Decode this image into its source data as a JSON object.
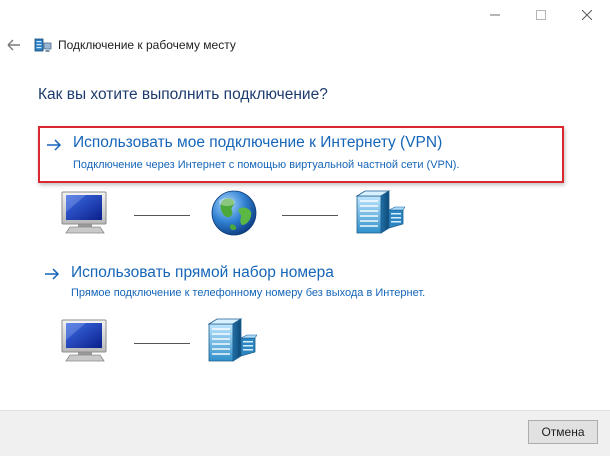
{
  "window": {
    "title": "Подключение к рабочему месту",
    "controls": {
      "minimize_icon": "minimize-icon",
      "maximize_icon": "maximize-icon",
      "close_icon": "close-icon"
    }
  },
  "question": "Как вы хотите выполнить подключение?",
  "options": [
    {
      "title": "Использовать мое подключение к Интернету (VPN)",
      "description": "Подключение через Интернет с помощью виртуальной частной сети (VPN).",
      "icons": [
        "computer-icon",
        "globe-icon",
        "server-icon"
      ],
      "highlighted": true
    },
    {
      "title": "Использовать прямой набор номера",
      "description": "Прямое подключение к телефонному номеру без выхода в Интернет.",
      "icons": [
        "computer-icon",
        "server-icon"
      ],
      "highlighted": false
    }
  ],
  "footer": {
    "cancel_label": "Отмена"
  },
  "colors": {
    "link": "#1565b8",
    "highlight_border": "#d9282f",
    "question": "#1e3b6e",
    "footer_bg": "#f0f0f0"
  }
}
